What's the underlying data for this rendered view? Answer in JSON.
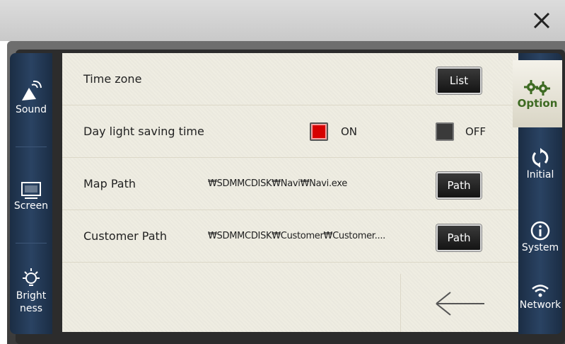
{
  "window": {
    "close_label": "✕"
  },
  "left_nav": [
    {
      "id": "sound",
      "label": "Sound",
      "icon": "sound-icon"
    },
    {
      "id": "screen",
      "label": "Screen",
      "icon": "screen-icon"
    },
    {
      "id": "brightness",
      "label_line1": "Bright",
      "label_line2": "ness",
      "icon": "brightness-icon"
    }
  ],
  "right_nav": [
    {
      "id": "option",
      "label": "Option",
      "icon": "gears-icon",
      "active": true
    },
    {
      "id": "initial",
      "label": "Initial",
      "icon": "refresh-icon"
    },
    {
      "id": "system",
      "label": "System",
      "icon": "info-icon"
    },
    {
      "id": "network",
      "label": "Network",
      "icon": "wifi-icon"
    }
  ],
  "settings": {
    "time_zone": {
      "label": "Time zone",
      "button": "List"
    },
    "dst": {
      "label": "Day light saving time",
      "on_label": "ON",
      "off_label": "OFF",
      "on_checked": true,
      "off_checked": false
    },
    "map_path": {
      "label": "Map Path",
      "value": "₩SDMMCDISK₩Navi₩Navi.exe",
      "button": "Path"
    },
    "customer_path": {
      "label": "Customer Path",
      "value": "₩SDMMCDISK₩Customer₩Customer....",
      "button": "Path"
    }
  },
  "back": {
    "icon": "back-arrow-icon"
  },
  "colors": {
    "accent_red": "#d60000",
    "nav_blue": "#233a58",
    "option_green": "#3d6a22"
  }
}
